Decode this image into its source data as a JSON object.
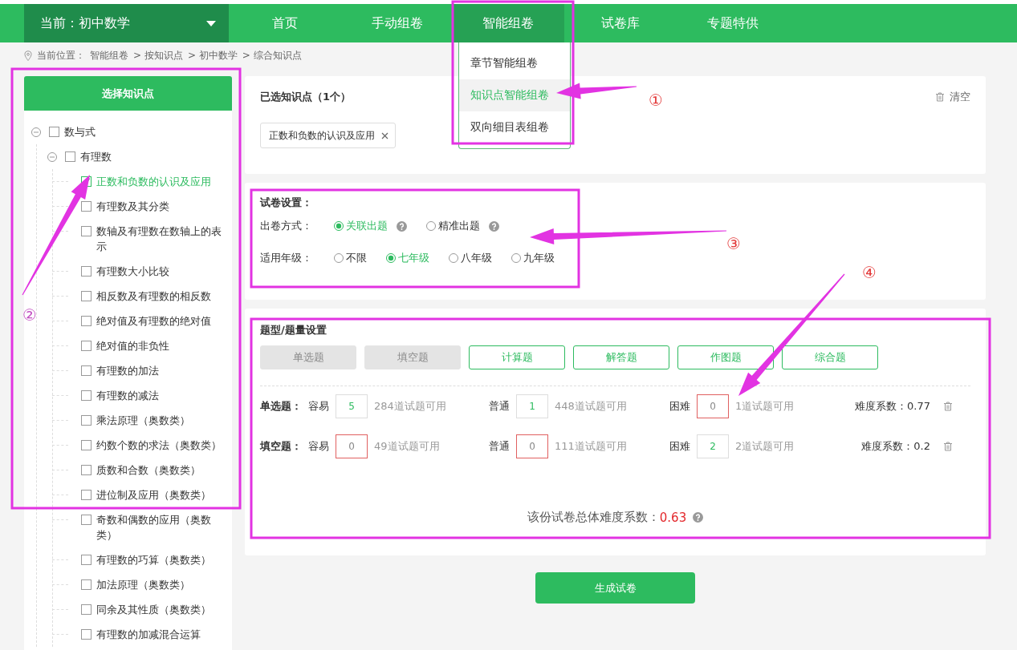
{
  "nav": {
    "current": "当前：初中数学",
    "items": [
      {
        "label": "首页",
        "selected": false
      },
      {
        "label": "手动组卷",
        "selected": false
      },
      {
        "label": "智能组卷",
        "selected": true,
        "menu": [
          {
            "label": "章节智能组卷",
            "selected": false
          },
          {
            "label": "知识点智能组卷",
            "selected": true
          },
          {
            "label": "双向细目表组卷",
            "selected": false
          }
        ]
      },
      {
        "label": "试卷库",
        "selected": false
      },
      {
        "label": "专题特供",
        "selected": false
      }
    ]
  },
  "breadcrumb": {
    "label": "当前位置：",
    "items": [
      "智能组卷",
      "> 按知识点",
      "> 初中数学",
      "> 综合知识点"
    ]
  },
  "sidebar": {
    "title": "选择知识点",
    "tree": [
      {
        "label": "数与式",
        "checked": false,
        "expanded": true,
        "children": [
          {
            "label": "有理数",
            "checked": false,
            "expanded": true,
            "children": [
              {
                "label": "正数和负数的认识及应用",
                "checked": true
              },
              {
                "label": "有理数及其分类",
                "checked": false
              },
              {
                "label": "数轴及有理数在数轴上的表示",
                "checked": false
              },
              {
                "label": "有理数大小比较",
                "checked": false
              },
              {
                "label": "相反数及有理数的相反数",
                "checked": false
              },
              {
                "label": "绝对值及有理数的绝对值",
                "checked": false
              },
              {
                "label": "绝对值的非负性",
                "checked": false
              },
              {
                "label": "有理数的加法",
                "checked": false
              },
              {
                "label": "有理数的减法",
                "checked": false
              },
              {
                "label": "乘法原理（奥数类）",
                "checked": false
              },
              {
                "label": "约数个数的求法（奥数类）",
                "checked": false
              },
              {
                "label": "质数和合数（奥数类）",
                "checked": false
              },
              {
                "label": "进位制及应用（奥数类）",
                "checked": false
              },
              {
                "label": "奇数和偶数的应用（奥数类）",
                "checked": false
              },
              {
                "label": "有理数的巧算（奥数类）",
                "checked": false
              },
              {
                "label": "加法原理（奥数类）",
                "checked": false
              },
              {
                "label": "同余及其性质（奥数类）",
                "checked": false
              },
              {
                "label": "有理数的加减混合运算",
                "checked": false
              }
            ]
          }
        ]
      }
    ]
  },
  "selected_points": {
    "title": "已选知识点（1个）",
    "clear": "清空",
    "tags": [
      "正数和负数的认识及应用"
    ]
  },
  "settings": {
    "title": "试卷设置：",
    "groups": [
      {
        "label": "出卷方式：",
        "options": [
          {
            "label": "关联出题",
            "selected": true,
            "help": true
          },
          {
            "label": "精准出题",
            "selected": false,
            "help": true
          }
        ]
      },
      {
        "label": "适用年级：",
        "options": [
          {
            "label": "不限",
            "selected": false,
            "help": false
          },
          {
            "label": "七年级",
            "selected": true,
            "help": false
          },
          {
            "label": "八年级",
            "selected": false,
            "help": false
          },
          {
            "label": "九年级",
            "selected": false,
            "help": false
          }
        ]
      }
    ]
  },
  "question_types": {
    "title": "题型/题量设置",
    "buttons": [
      {
        "label": "单选题",
        "disabled": true
      },
      {
        "label": "填空题",
        "disabled": true
      },
      {
        "label": "计算题",
        "disabled": false
      },
      {
        "label": "解答题",
        "disabled": false
      },
      {
        "label": "作图题",
        "disabled": false
      },
      {
        "label": "综合题",
        "disabled": false
      }
    ],
    "rows": [
      {
        "label": "单选题：",
        "levels": [
          {
            "label": "容易",
            "value": "5",
            "invalid": false,
            "available": "284道试题可用"
          },
          {
            "label": "普通",
            "value": "1",
            "invalid": false,
            "available": "448道试题可用"
          },
          {
            "label": "困难",
            "value": "0",
            "invalid": true,
            "available": "1道试题可用"
          }
        ],
        "difficulty": "难度系数：0.77"
      },
      {
        "label": "填空题：",
        "levels": [
          {
            "label": "容易",
            "value": "0",
            "invalid": true,
            "available": "49道试题可用"
          },
          {
            "label": "普通",
            "value": "0",
            "invalid": true,
            "available": "111道试题可用"
          },
          {
            "label": "困难",
            "value": "2",
            "invalid": false,
            "available": "2道试题可用"
          }
        ],
        "difficulty": "难度系数：0.2"
      }
    ],
    "total_label": "该份试卷总体难度系数：",
    "total_value": "0.63"
  },
  "generate_button": "生成试卷",
  "annotations": [
    {
      "label": "①"
    },
    {
      "label": "②"
    },
    {
      "label": "③"
    },
    {
      "label": "④"
    }
  ]
}
